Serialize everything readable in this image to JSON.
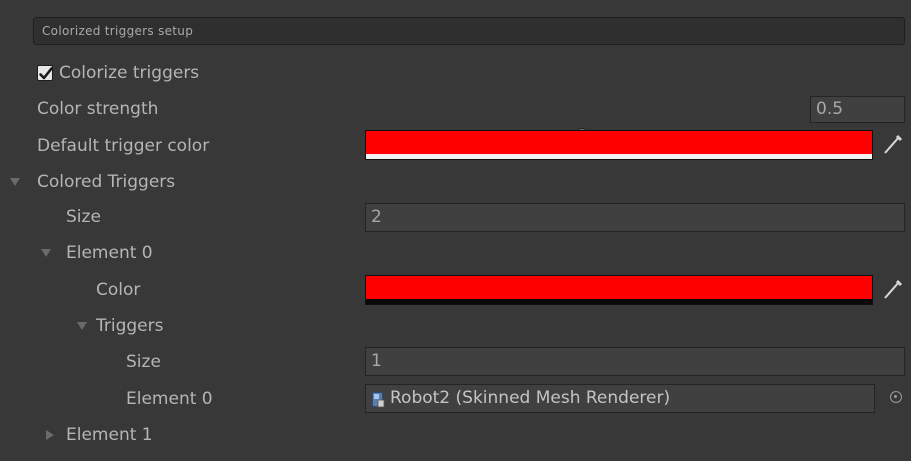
{
  "header": {
    "title": "Colorized triggers setup"
  },
  "colorize_triggers": {
    "label": "Colorize triggers",
    "checked": true
  },
  "color_strength": {
    "label": "Color strength",
    "value": "0.5",
    "fraction": 0.5
  },
  "default_trigger_color": {
    "label": "Default trigger color",
    "color": "#ff0000",
    "alpha_bar_color": "#f2f2f2"
  },
  "colored_triggers": {
    "label": "Colored Triggers",
    "size_label": "Size",
    "size_value": "2",
    "element0": {
      "label": "Element 0",
      "color_label": "Color",
      "color": "#ff0000",
      "alpha_bar_color": "#0a0a0a",
      "triggers": {
        "label": "Triggers",
        "size_label": "Size",
        "size_value": "1",
        "element0": {
          "label": "Element 0",
          "value": "Robot2 (Skinned Mesh Renderer)",
          "icon": "skinned-mesh-renderer-icon"
        }
      }
    },
    "element1": {
      "label": "Element 1"
    }
  },
  "icons": {
    "eyedropper": "eyedropper-icon",
    "object_picker": "object-picker-icon"
  }
}
